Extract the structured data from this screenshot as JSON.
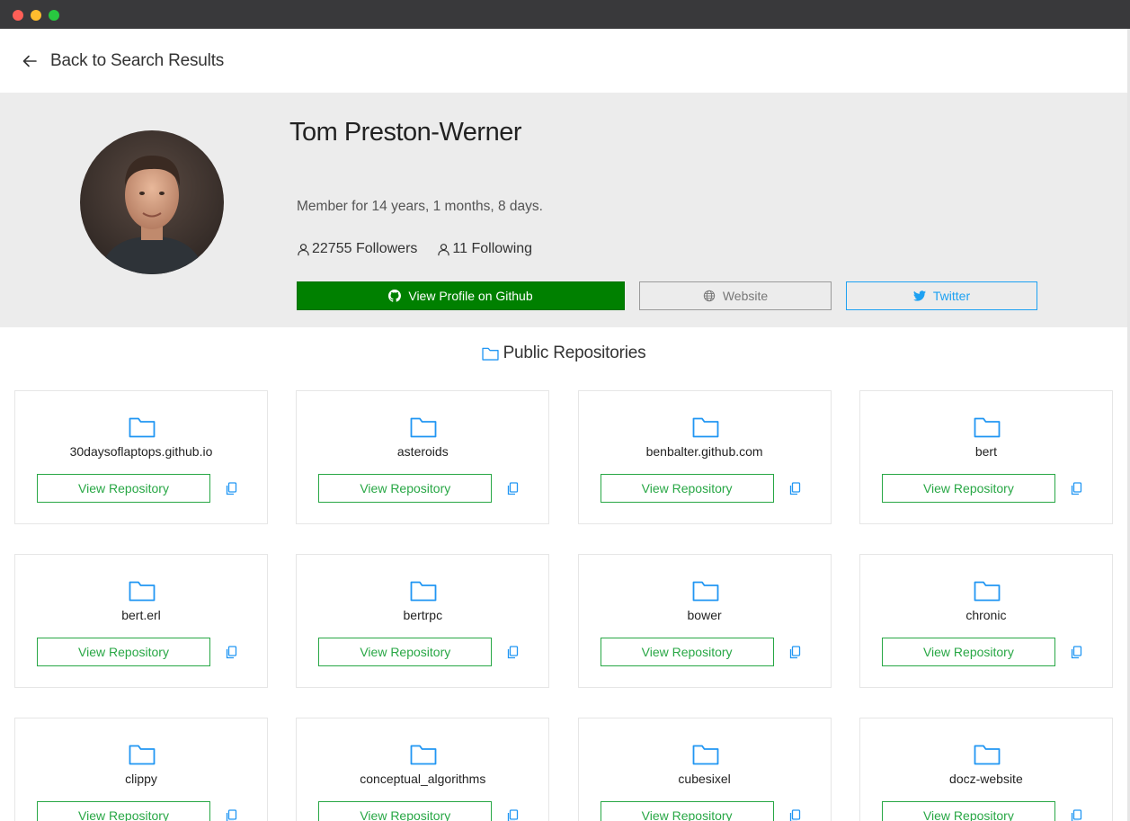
{
  "nav": {
    "back_label": "Back to Search Results"
  },
  "profile": {
    "name": "Tom Preston-Werner",
    "member_since": "Member for 14 years, 1 months, 8 days.",
    "followers": "22755 Followers",
    "following": "11 Following",
    "buttons": {
      "github": "View Profile on Github",
      "website": "Website",
      "twitter": "Twitter"
    }
  },
  "repos": {
    "title": "Public Repositories",
    "view_label": "View Repository",
    "items": [
      "30daysoflaptops.github.io",
      "asteroids",
      "benbalter.github.com",
      "bert",
      "bert.erl",
      "bertrpc",
      "bower",
      "chronic",
      "clippy",
      "conceptual_algorithms",
      "cubesixel",
      "docz-website"
    ]
  },
  "colors": {
    "github_green": "#008000",
    "repo_green": "#28a745",
    "twitter_blue": "#1da1f2",
    "folder_blue": "#2196f3"
  }
}
